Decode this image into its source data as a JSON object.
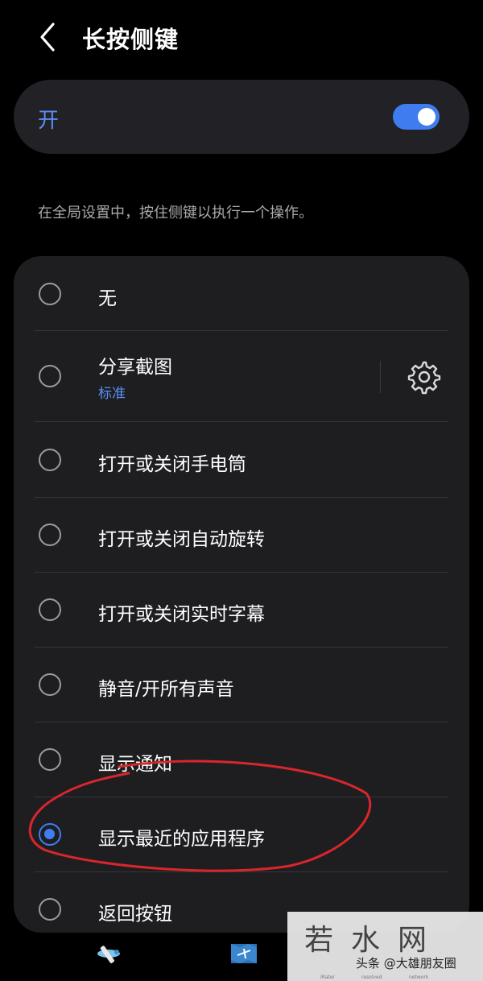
{
  "header": {
    "title": "长按侧键",
    "back_icon": "chevron-left-icon"
  },
  "master_switch": {
    "label": "开",
    "state": "on",
    "accent": "#3e7cf0"
  },
  "description": "在全局设置中，按住侧键以执行一个操作。",
  "options": [
    {
      "label": "无",
      "selected": false
    },
    {
      "label": "分享截图",
      "sublabel": "标准",
      "selected": false,
      "settings_icon": "gear-icon"
    },
    {
      "label": "打开或关闭手电筒",
      "selected": false
    },
    {
      "label": "打开或关闭自动旋转",
      "selected": false
    },
    {
      "label": "打开或关闭实时字幕",
      "selected": false
    },
    {
      "label": "静音/开所有声音",
      "selected": false
    },
    {
      "label": "显示通知",
      "selected": false
    },
    {
      "label": "显示最近的应用程序",
      "selected": true
    },
    {
      "label": "返回按钮",
      "selected": false
    }
  ],
  "annotation": {
    "shape": "hand-drawn ellipse",
    "color": "#d9262c"
  },
  "bottom_bar": {
    "icons": [
      "airplane-icon",
      "map-airplane-icon"
    ]
  },
  "watermark": {
    "title": "若水网",
    "credit": "头条 @大雄朋友圈",
    "tiny": [
      "iRater",
      "resolved",
      "network"
    ]
  }
}
